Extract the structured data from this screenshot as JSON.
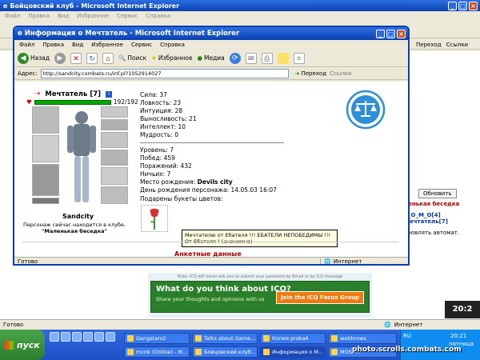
{
  "background_window": {
    "title": "Бойцовский клуб - Microsoft Internet Explorer",
    "menu": [
      "Файл",
      "Правка",
      "Вид",
      "Избранное",
      "Сервис",
      "Справка"
    ],
    "goto_label": "Переход",
    "links_label": "Ссылки",
    "status_text": "Готово",
    "zone_text": "Интернет",
    "right_panel": {
      "room_name": "ленькая беседка",
      "refresh_button": "Обновить",
      "user1": "S_O_M_O[4]",
      "user2": "Мечтатель[7]",
      "auto_update_text": "бновлять автомат."
    },
    "icq": {
      "note": "Note: ICQ will never ask you to submit your password by Email or by ICQ message",
      "question": "What do you think about ICQ?",
      "subtitle": "Share your thoughts and opinions with us",
      "join_button": "Join the ICQ Focus Group"
    },
    "clock_widget": "20:2"
  },
  "dialog": {
    "title": "Информация о Мечтатель - Microsoft Internet Explorer",
    "menu": [
      "Файл",
      "Правка",
      "Вид",
      "Избранное",
      "Сервис",
      "Справка"
    ],
    "toolbar": {
      "back": "Назад",
      "search": "Поиск",
      "favorites": "Избранное",
      "media": "Медиа"
    },
    "address_label": "Адрес:",
    "address_value": "http://sandcity.combats.ru/inf.pl?1052914027",
    "goto_label": "Переход",
    "links_label": "Ссылки",
    "status_text": "Готово",
    "zone_text": "Интернет"
  },
  "character": {
    "name": "Мечтатель [7]",
    "hp": "192/192",
    "hp_fraction": 1.0,
    "city": "Sandcity",
    "location_line": "Персонаж сейчас находится в клубе.",
    "location_room": "\"Маленькая беседка\""
  },
  "stats": {
    "strength": "Сила: 37",
    "agility": "Ловкость: 23",
    "intuition": "Интуиция: 28",
    "endurance": "Выносливость: 21",
    "intellect": "Интеллект: 10",
    "wisdom": "Мудрость: 0",
    "level": "Уровень: 7",
    "wins": "Побед: 459",
    "losses": "Поражений: 432",
    "draws": "Ничьих: 7",
    "birthplace_label": "Место рождения:",
    "birthplace_value": "Devils city",
    "birthday": "День рождения персонажа: 14.05.03 16:07"
  },
  "bouquets_title": "Подарены букеты цветов:",
  "tooltip": "Мечтателю от Ебателя !!! ЕБАТЕЛИ НЕПОБЕДИМЫ !!! От Ебателя ! (анонимно)",
  "anketa": "Анкетные данные",
  "taskbar": {
    "start": "пуск",
    "tasks": [
      "Gangstars2",
      "Talks about Game...",
      "Копия proka4",
      "webbrows",
      "mcnk (Online) - M...",
      "Бойцовский клуб...",
      "Информация о М...",
      "MOSA..."
    ],
    "lang": "RU",
    "time": "20:21",
    "day": "пятница"
  },
  "watermark": "photo.scrolls.combats.com"
}
